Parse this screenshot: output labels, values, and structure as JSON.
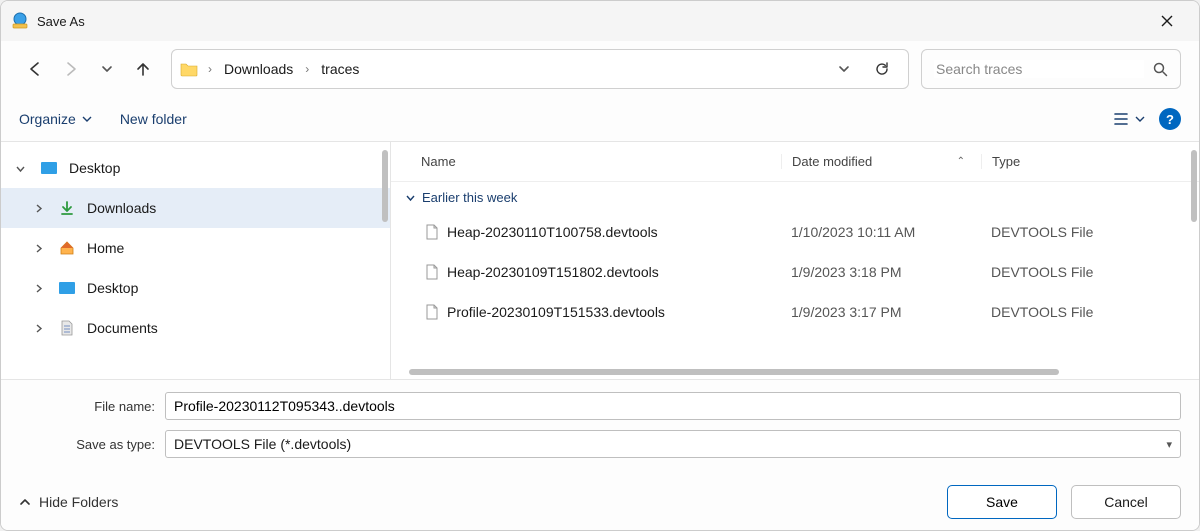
{
  "title": "Save As",
  "breadcrumb": {
    "segments": [
      "Downloads",
      "traces"
    ]
  },
  "search": {
    "placeholder": "Search traces"
  },
  "toolbar": {
    "organize": "Organize",
    "new_folder": "New folder"
  },
  "sidebar": {
    "items": [
      {
        "label": "Desktop",
        "icon": "desktop",
        "expanded": true,
        "depth": 0,
        "selected": false
      },
      {
        "label": "Downloads",
        "icon": "download",
        "expanded": false,
        "depth": 1,
        "selected": true
      },
      {
        "label": "Home",
        "icon": "home",
        "expanded": false,
        "depth": 1,
        "selected": false
      },
      {
        "label": "Desktop",
        "icon": "desktop",
        "expanded": false,
        "depth": 1,
        "selected": false
      },
      {
        "label": "Documents",
        "icon": "document",
        "expanded": false,
        "depth": 1,
        "selected": false
      }
    ]
  },
  "columns": {
    "name": "Name",
    "date": "Date modified",
    "type": "Type"
  },
  "group_header": "Earlier this week",
  "files": [
    {
      "name": "Heap-20230110T100758.devtools",
      "date": "1/10/2023 10:11 AM",
      "type": "DEVTOOLS File"
    },
    {
      "name": "Heap-20230109T151802.devtools",
      "date": "1/9/2023 3:18 PM",
      "type": "DEVTOOLS File"
    },
    {
      "name": "Profile-20230109T151533.devtools",
      "date": "1/9/2023 3:17 PM",
      "type": "DEVTOOLS File"
    }
  ],
  "form": {
    "file_name_label": "File name:",
    "file_name_value": "Profile-20230112T095343..devtools",
    "save_type_label": "Save as type:",
    "save_type_value": "DEVTOOLS File (*.devtools)"
  },
  "footer": {
    "hide_folders": "Hide Folders",
    "save": "Save",
    "cancel": "Cancel"
  }
}
